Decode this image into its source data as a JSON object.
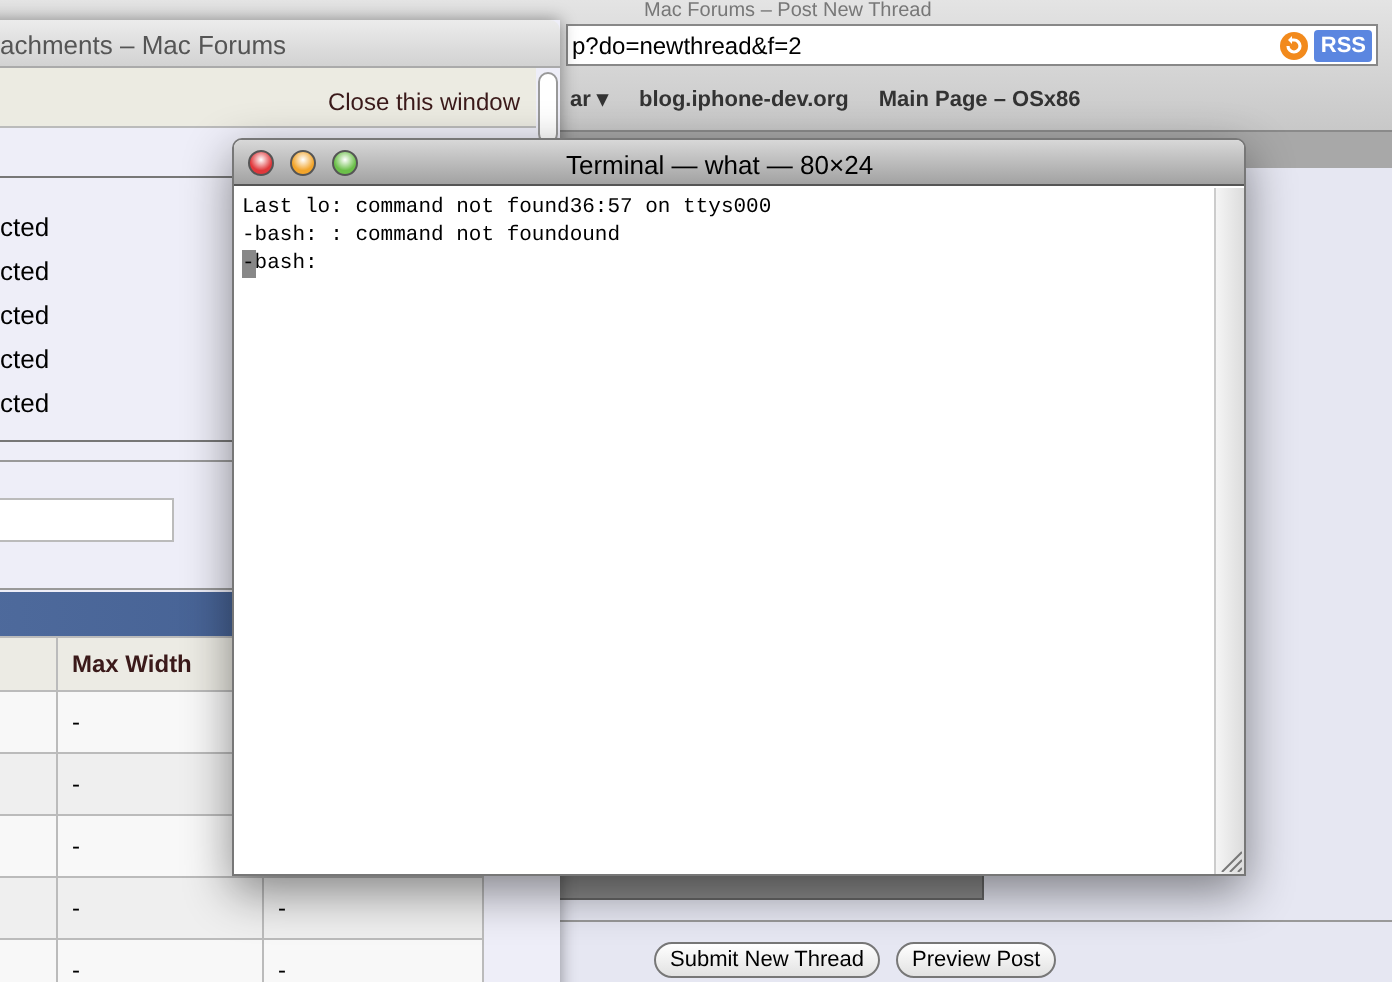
{
  "browser_window": {
    "title": "Mac Forums – Post New Thread",
    "address": "p?do=newthread&f=2",
    "feed_badge": "RSS",
    "bookmarks": [
      "ar ▾",
      "blog.iphone-dev.org",
      "Main Page – OSx86"
    ],
    "buttons": [
      "Submit New Thread",
      "Preview Post"
    ]
  },
  "attachments_window": {
    "title": "achments – Mac Forums",
    "close_link": "Close this window",
    "list_items": [
      "cted",
      "cted",
      "cted",
      "cted",
      "cted"
    ],
    "table": {
      "columns": [
        "",
        "Max Width",
        ""
      ],
      "rows": [
        [
          "",
          "-",
          ""
        ],
        [
          "",
          "-",
          ""
        ],
        [
          "",
          "-",
          ""
        ],
        [
          "",
          "-",
          "-"
        ],
        [
          "",
          "-",
          "-"
        ]
      ]
    }
  },
  "terminal": {
    "title": "Terminal — what — 80×24",
    "lines": [
      "Last lo: command not found36:57 on ttys000",
      "-bash: : command not foundound",
      "-bash:"
    ]
  }
}
